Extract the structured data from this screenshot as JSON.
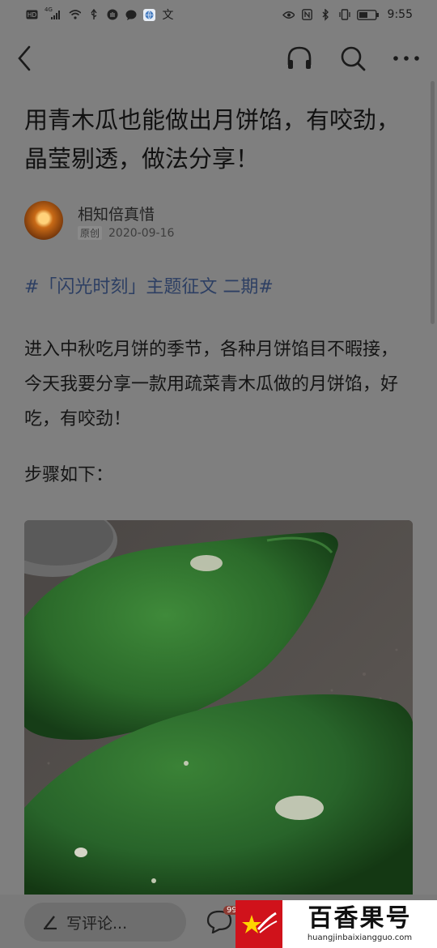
{
  "status_bar": {
    "left_icons": [
      "hd-icon",
      "signal-4g-icon",
      "wifi-icon",
      "usb-icon",
      "hand-icon",
      "chat-bubble-icon",
      "browser-icon",
      "translate-icon"
    ],
    "right_icons": [
      "eye-icon",
      "nfc-icon",
      "bluetooth-icon",
      "vibrate-icon",
      "battery-icon"
    ],
    "network": "4G",
    "translate_glyph": "文",
    "time": "9:55"
  },
  "nav": {
    "icons": [
      "back-icon",
      "headphones-icon",
      "search-icon",
      "more-icon"
    ]
  },
  "article": {
    "title": "用青木瓜也能做出月饼馅，有咬劲，晶莹剔透，做法分享！",
    "author": {
      "name": "相知倍真惜",
      "badge": "原创",
      "date": "2020-09-16"
    },
    "topic": "#「闪光时刻」主题征文 二期#",
    "paragraph": "进入中秋吃月饼的季节，各种月饼馅目不暇接，今天我要分享一款用疏菜青木瓜做的月饼馅，好吃，有咬劲！",
    "steps_heading": "步骤如下："
  },
  "bottom_bar": {
    "comment_placeholder": "写评论...",
    "comment_count": "99"
  },
  "watermark": {
    "title": "百香果号",
    "url": "huangjinbaixiangguo.com",
    "brand_color": "#d0121b"
  }
}
